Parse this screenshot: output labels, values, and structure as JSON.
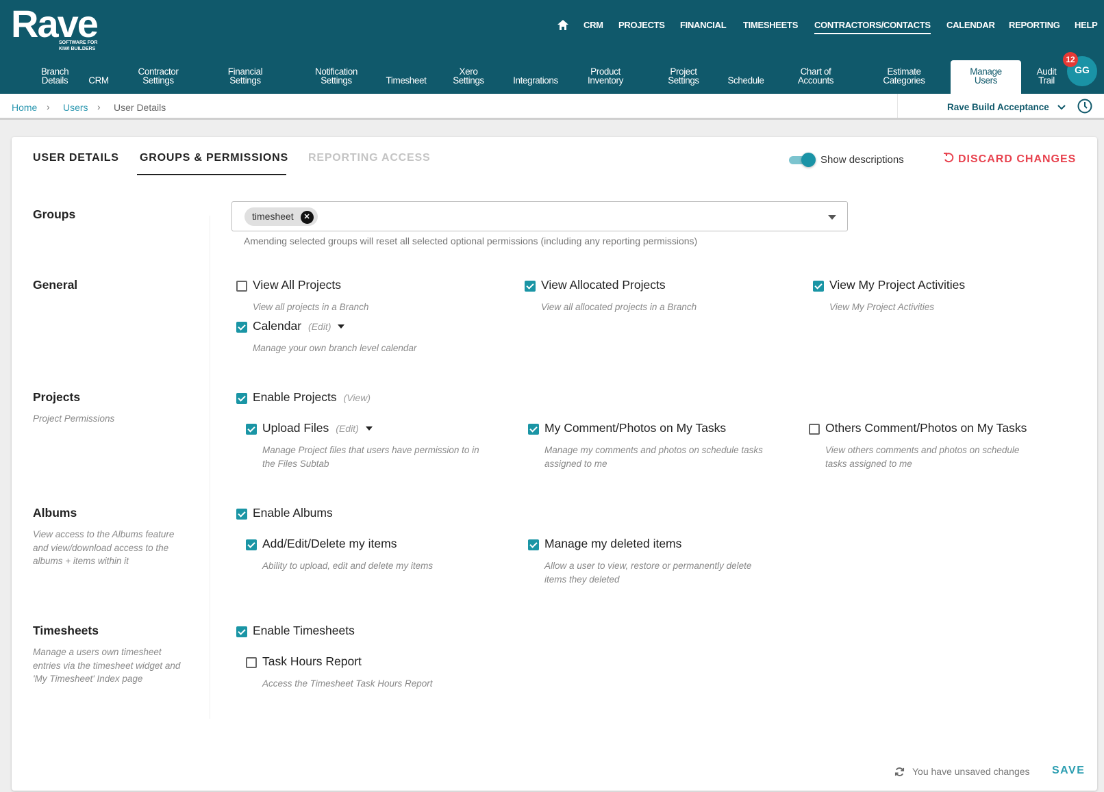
{
  "logo": {
    "text": "Rave",
    "tagline_1": "SOFTWARE FOR",
    "tagline_2": "KIWI BUILDERS"
  },
  "topnav": {
    "items": [
      "CRM",
      "PROJECTS",
      "FINANCIAL",
      "TIMESHEETS",
      "CONTRACTORS/CONTACTS",
      "CALENDAR",
      "REPORTING",
      "HELP"
    ],
    "active": "CONTRACTORS/CONTACTS"
  },
  "subnav": {
    "items": [
      [
        "Branch",
        "Details"
      ],
      [
        "",
        "CRM"
      ],
      [
        "Contractor",
        "Settings"
      ],
      [
        "Financial",
        "Settings"
      ],
      [
        "Notification",
        "Settings"
      ],
      [
        "",
        "Timesheet"
      ],
      [
        "Xero",
        "Settings"
      ],
      [
        "",
        "Integrations"
      ],
      [
        "Product",
        "Inventory"
      ],
      [
        "Project",
        "Settings"
      ],
      [
        "",
        "Schedule"
      ],
      [
        "Chart of",
        "Accounts"
      ],
      [
        "Estimate",
        "Categories"
      ],
      [
        "Manage",
        "Users"
      ],
      [
        "Audit",
        "Trail"
      ]
    ],
    "active": "Manage Users"
  },
  "user": {
    "initials": "GG",
    "notifications": "12"
  },
  "breadcrumb": {
    "home": "Home",
    "users": "Users",
    "current": "User Details",
    "sep": "›"
  },
  "branch": {
    "selected": "Rave Build Acceptance"
  },
  "tabs": {
    "user_details": "USER DETAILS",
    "groups_permissions": "GROUPS & PERMISSIONS",
    "reporting_access": "REPORTING ACCESS",
    "active": "GROUPS & PERMISSIONS"
  },
  "toolbar": {
    "show_descriptions_label": "Show descriptions",
    "show_descriptions": true,
    "discard_label": "DISCARD CHANGES"
  },
  "groups": {
    "label": "Groups",
    "chips": [
      "timesheet"
    ],
    "help": "Amending selected groups will reset all selected optional permissions (including any reporting permissions)"
  },
  "sections": {
    "general": {
      "title": "General",
      "view_all": {
        "label": "View All Projects",
        "desc": "View all projects in a Branch",
        "checked": false
      },
      "view_allocated": {
        "label": "View Allocated Projects",
        "desc": "View all allocated projects in a Branch",
        "checked": true
      },
      "view_activities": {
        "label": "View My Project Activities",
        "desc": "View My Project Activities",
        "checked": true
      },
      "calendar": {
        "label": "Calendar",
        "hint": "(Edit)",
        "desc": "Manage your own branch level calendar",
        "checked": true
      }
    },
    "projects": {
      "title": "Projects",
      "desc": "Project Permissions",
      "enable": {
        "label": "Enable Projects",
        "hint": "(View)",
        "checked": true
      },
      "upload": {
        "label": "Upload Files",
        "hint": "(Edit)",
        "desc": "Manage Project files that users have permission to in the Files Subtab",
        "checked": true
      },
      "my_comments": {
        "label": "My Comment/Photos on My Tasks",
        "desc": "Manage my comments and photos on schedule tasks assigned to me",
        "checked": true
      },
      "others_comments": {
        "label": "Others Comment/Photos on My Tasks",
        "desc": "View others comments and photos on schedule tasks assigned to me",
        "checked": false
      }
    },
    "albums": {
      "title": "Albums",
      "desc": "View access to the Albums feature and view/download access to the albums + items within it",
      "enable": {
        "label": "Enable Albums",
        "checked": true
      },
      "add_edit": {
        "label": "Add/Edit/Delete my items",
        "desc": "Ability to upload, edit and delete my items",
        "checked": true
      },
      "deleted": {
        "label": "Manage my deleted items",
        "desc": "Allow a user to view, restore or permanently delete items they deleted",
        "checked": true
      }
    },
    "timesheets": {
      "title": "Timesheets",
      "desc": "Manage a users own timesheet entries via the timesheet widget and 'My Timesheet' Index page",
      "enable": {
        "label": "Enable Timesheets",
        "checked": true
      },
      "task_hours": {
        "label": "Task Hours Report",
        "desc": "Access the Timesheet Task Hours Report",
        "checked": false
      }
    }
  },
  "footer": {
    "status": "You have unsaved changes",
    "save_label": "SAVE"
  },
  "colors": {
    "header": "#10596b",
    "accent": "#1a95a5",
    "danger": "#e8434f"
  }
}
